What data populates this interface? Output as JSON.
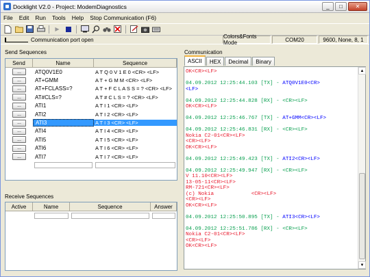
{
  "window": {
    "title": "Docklight V2.0 - Project: ModemDiagnostics",
    "controls": [
      "_",
      "□",
      "✕"
    ]
  },
  "menu": {
    "items": [
      "File",
      "Edit",
      "Run",
      "Tools",
      "Help"
    ],
    "stop_label": "Stop Communication  (F6)"
  },
  "toolbar": {
    "icons": [
      "new-icon",
      "open-icon",
      "save-icon",
      "print-icon",
      "play-icon",
      "stop-icon",
      "settings-icon",
      "find-icon",
      "binoculars-icon",
      "clear-icon",
      "edit-icon",
      "camera-icon",
      "keyboard-icon"
    ]
  },
  "status": {
    "port_text": "Communication port open",
    "mode": "Colors&Fonts Mode",
    "port": "COM20",
    "settings": "9600, None, 8, 1"
  },
  "send": {
    "label": "Send Sequences",
    "headers": [
      "Send",
      "Name",
      "Sequence"
    ],
    "rows": [
      {
        "name": "ATQ0V1E0",
        "seq": "A T Q 0 V 1 E 0 <CR> <LF>"
      },
      {
        "name": "AT+GMM",
        "seq": "A T + G M M <CR> <LF>"
      },
      {
        "name": "AT+FCLASS=?",
        "seq": "A T + F C L A S S = ? <CR> <LF>"
      },
      {
        "name": "AT#CLS=?",
        "seq": "A T # C L S = ? <CR> <LF>"
      },
      {
        "name": "ATI1",
        "seq": "A T I 1 <CR> <LF>"
      },
      {
        "name": "ATI2",
        "seq": "A T I 2 <CR> <LF>"
      },
      {
        "name": "ATI3",
        "seq": "A T I 3 <CR> <LF>",
        "selected": true
      },
      {
        "name": "ATI4",
        "seq": "A T I 4 <CR> <LF>"
      },
      {
        "name": "ATI5",
        "seq": "A T I 5 <CR> <LF>"
      },
      {
        "name": "ATI6",
        "seq": "A T I 6 <CR> <LF>"
      },
      {
        "name": "ATI7",
        "seq": "A T I 7 <CR> <LF>"
      }
    ],
    "button_label": "..."
  },
  "receive": {
    "label": "Receive Sequences",
    "headers": [
      "Active",
      "Name",
      "Sequence",
      "Answer"
    ]
  },
  "comm": {
    "label": "Communication",
    "tabs": [
      "ASCII",
      "HEX",
      "Decimal",
      "Binary"
    ],
    "active_tab": "ASCII"
  },
  "log": [
    {
      "lines": [
        {
          "c": "rx",
          "t": "OK<CR><LF>"
        }
      ]
    },
    {
      "lines": [
        {
          "c": "ts",
          "t": "04.09.2012 12:25:44.103 [TX] - ",
          "c2": "tx",
          "t2": "ATQ0V1E0<CR>"
        },
        {
          "c": "tx",
          "t": "<LF>"
        }
      ]
    },
    {
      "lines": [
        {
          "c": "ts",
          "t": "04.09.2012 12:25:44.828 [RX] - <CR><LF>"
        },
        {
          "c": "rx",
          "t": "OK<CR><LF>"
        }
      ]
    },
    {
      "lines": [
        {
          "c": "ts",
          "t": "04.09.2012 12:25:46.767 [TX] - ",
          "c2": "tx",
          "t2": "AT+GMM<CR><LF>"
        }
      ]
    },
    {
      "lines": [
        {
          "c": "ts",
          "t": "04.09.2012 12:25:46.831 [RX] - <CR><LF>"
        },
        {
          "c": "rx",
          "t": "Nokia C2-01<CR><LF>"
        },
        {
          "c": "rx",
          "t": "<CR><LF>"
        },
        {
          "c": "rx",
          "t": "OK<CR><LF>"
        }
      ]
    },
    {
      "lines": [
        {
          "c": "ts",
          "t": "04.09.2012 12:25:49.423 [TX] - ",
          "c2": "tx",
          "t2": "ATI2<CR><LF>"
        }
      ]
    },
    {
      "lines": [
        {
          "c": "ts",
          "t": "04.09.2012 12:25:49.947 [RX] - <CR><LF>"
        },
        {
          "c": "rx",
          "t": "V 11.10<CR><LF>"
        },
        {
          "c": "rx",
          "t": "13-05-11<CR><LF>"
        },
        {
          "c": "rx",
          "t": "RM-721<CR><LF>"
        },
        {
          "c": "rx",
          "t": "(c) Nokia            <CR><LF>"
        },
        {
          "c": "rx",
          "t": "<CR><LF>"
        },
        {
          "c": "rx",
          "t": "OK<CR><LF>"
        }
      ]
    },
    {
      "lines": [
        {
          "c": "ts",
          "t": "04.09.2012 12:25:50.895 [TX] - ",
          "c2": "tx",
          "t2": "ATI3<CR><LF>"
        }
      ]
    },
    {
      "lines": [
        {
          "c": "ts",
          "t": "04.09.2012 12:25:51.786 [RX] - <CR><LF>"
        },
        {
          "c": "rx",
          "t": "Nokia C2-01<CR><LF>"
        },
        {
          "c": "rx",
          "t": "<CR><LF>"
        },
        {
          "c": "rx",
          "t": "OK<CR><LF>"
        }
      ]
    }
  ]
}
